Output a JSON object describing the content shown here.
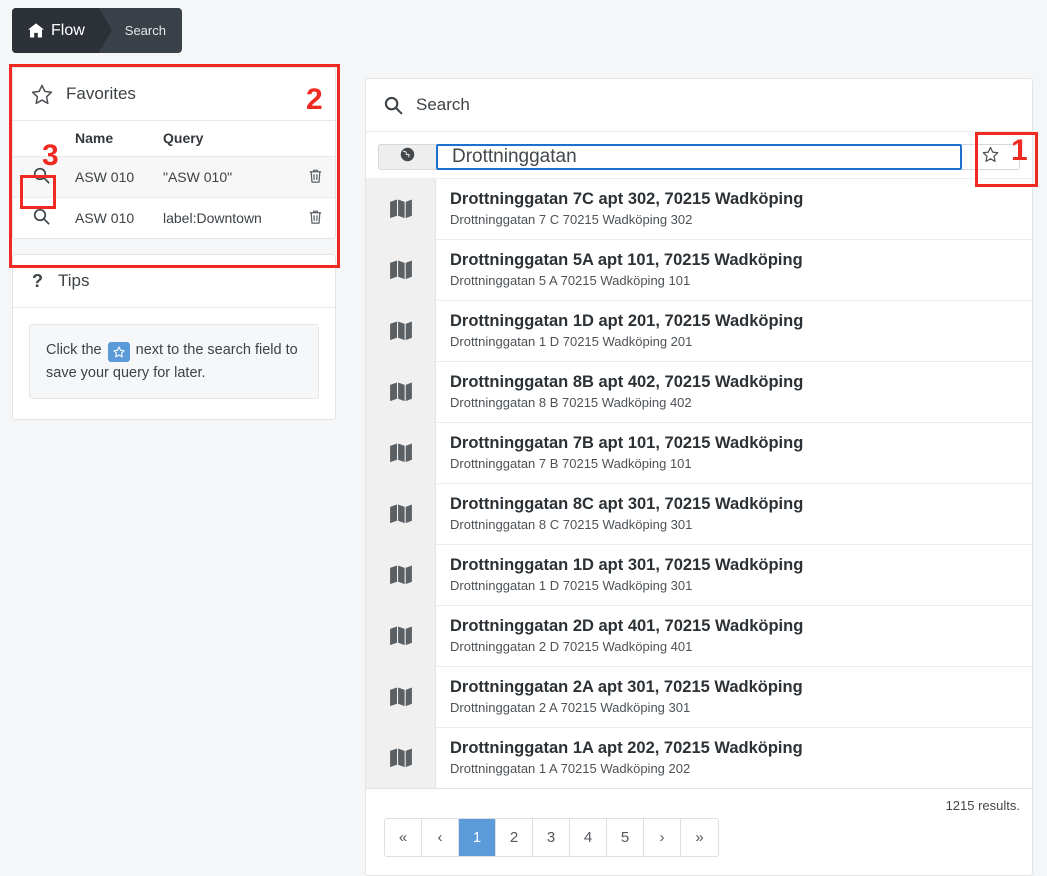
{
  "breadcrumb": {
    "home_label": "Flow",
    "home_icon": "home-icon",
    "current_label": "Search"
  },
  "favorites": {
    "title": "Favorites",
    "icon": "star-outline-icon",
    "columns": [
      "Name",
      "Query"
    ],
    "rows": [
      {
        "name": "ASW 010",
        "query": "\"ASW 010\"",
        "search_icon": "magnifier-icon",
        "delete_icon": "trash-icon"
      },
      {
        "name": "ASW 010",
        "query": "label:Downtown",
        "search_icon": "magnifier-icon",
        "delete_icon": "trash-icon"
      }
    ]
  },
  "tips": {
    "title": "Tips",
    "icon": "question-mark-icon",
    "text_before": "Click the",
    "badge_icon": "star-icon",
    "text_after": "next to the search field to save your query for later."
  },
  "search": {
    "title": "Search",
    "title_icon": "magnifier-icon",
    "addon_icon": "globe-icon",
    "input_value": "Drottninggatan",
    "input_placeholder": "",
    "favorite_icon": "star-outline-icon"
  },
  "results": {
    "item_icon": "map-icon",
    "items": [
      {
        "title": "Drottninggatan 7C apt 302, 70215 Wadköping",
        "subtitle": "Drottninggatan 7 C 70215 Wadköping 302"
      },
      {
        "title": "Drottninggatan 5A apt 101, 70215 Wadköping",
        "subtitle": "Drottninggatan 5 A 70215 Wadköping 101"
      },
      {
        "title": "Drottninggatan 1D apt 201, 70215 Wadköping",
        "subtitle": "Drottninggatan 1 D 70215 Wadköping 201"
      },
      {
        "title": "Drottninggatan 8B apt 402, 70215 Wadköping",
        "subtitle": "Drottninggatan 8 B 70215 Wadköping 402"
      },
      {
        "title": "Drottninggatan 7B apt 101, 70215 Wadköping",
        "subtitle": "Drottninggatan 7 B 70215 Wadköping 101"
      },
      {
        "title": "Drottninggatan 8C apt 301, 70215 Wadköping",
        "subtitle": "Drottninggatan 8 C 70215 Wadköping 301"
      },
      {
        "title": "Drottninggatan 1D apt 301, 70215 Wadköping",
        "subtitle": "Drottninggatan 1 D 70215 Wadköping 301"
      },
      {
        "title": "Drottninggatan 2D apt 401, 70215 Wadköping",
        "subtitle": "Drottninggatan 2 D 70215 Wadköping 401"
      },
      {
        "title": "Drottninggatan 2A apt 301, 70215 Wadköping",
        "subtitle": "Drottninggatan 2 A 70215 Wadköping 301"
      },
      {
        "title": "Drottninggatan 1A apt 202, 70215 Wadköping",
        "subtitle": "Drottninggatan 1 A 70215 Wadköping 202"
      }
    ],
    "count_label": "1215 results."
  },
  "pagination": {
    "first": "«",
    "prev": "‹",
    "pages": [
      "1",
      "2",
      "3",
      "4",
      "5"
    ],
    "active_page": "1",
    "next": "›",
    "last": "»"
  },
  "annotations": [
    {
      "number": "1",
      "target": "favorite-star-button"
    },
    {
      "number": "2",
      "target": "favorites-panel"
    },
    {
      "number": "3",
      "target": "favorite-row-search-button"
    }
  ],
  "colors": {
    "accent_blue": "#5b9bd9",
    "focus_border": "#1d6fd0",
    "annotation_red": "#ef2a20",
    "breadcrumb_dark": "#2b3137",
    "breadcrumb_light": "#3a4148",
    "page_background": "#f4f6f8"
  }
}
